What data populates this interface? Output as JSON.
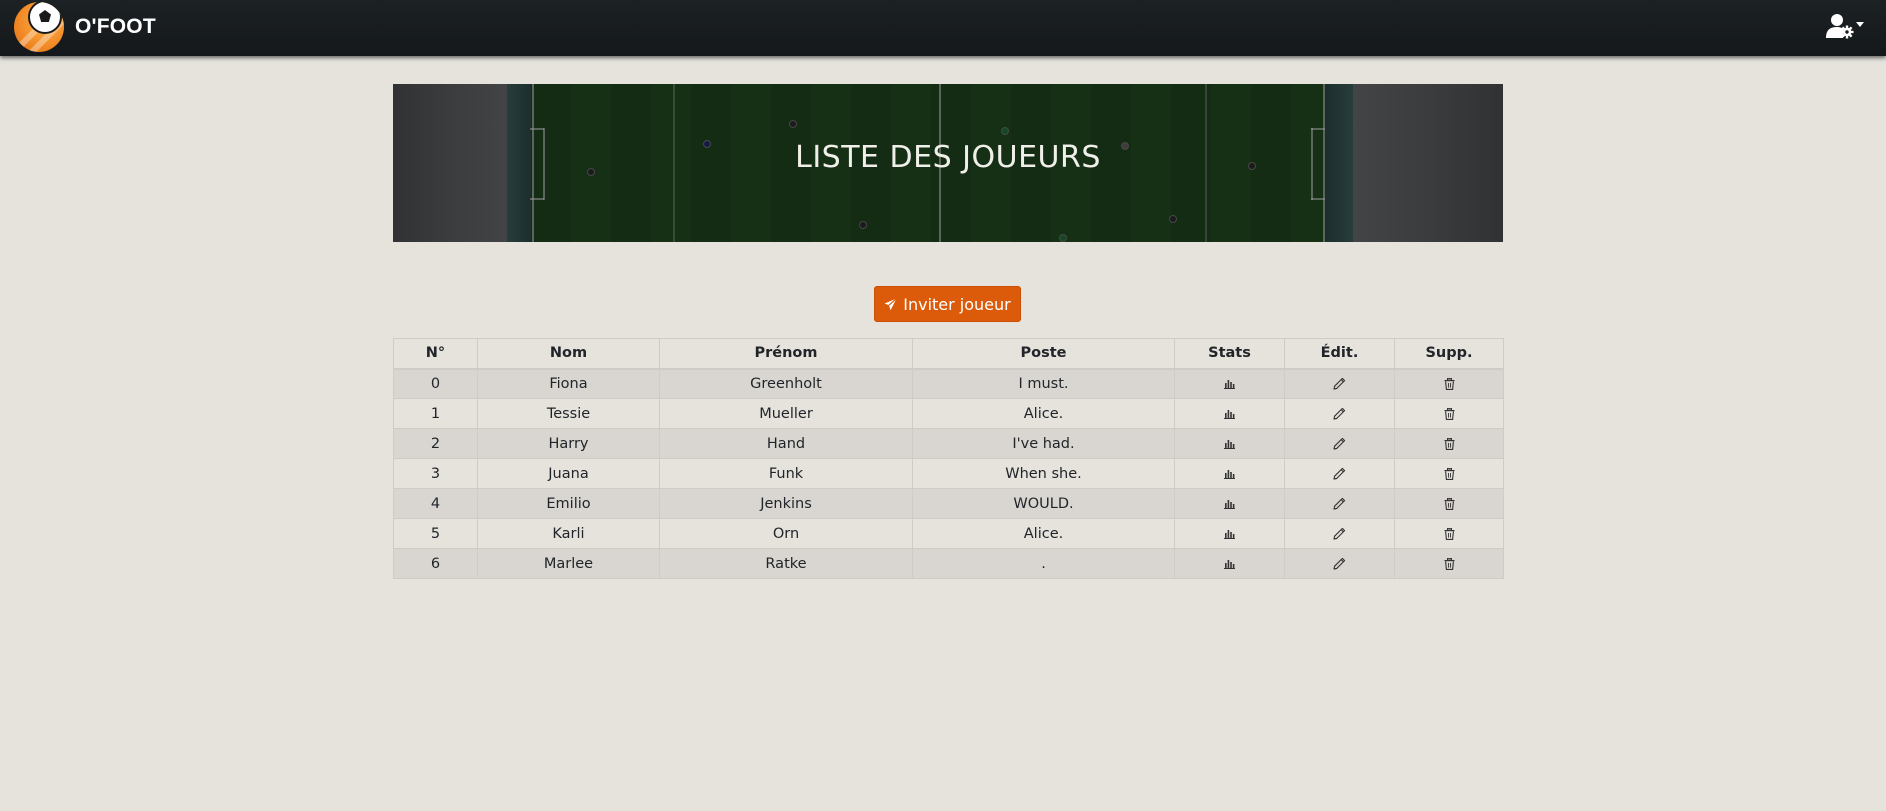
{
  "brand": {
    "name": "O'FOOT"
  },
  "icons": {
    "logo": "soccer-ball-logo",
    "user_menu": "user-cog-icon",
    "invite": "send-icon",
    "stats": "chart-bar-icon",
    "edit": "pencil-icon",
    "delete": "trash-icon"
  },
  "colors": {
    "navbar": "#171b1e",
    "background": "#e6e3dd",
    "accent": "#dc5b0a",
    "row_striped": "#d9d6d1"
  },
  "banner": {
    "title": "LISTE DES JOUEURS"
  },
  "invite_button": {
    "label": "Inviter joueur"
  },
  "table": {
    "headers": {
      "number": "N°",
      "last_name": "Nom",
      "first_name": "Prénom",
      "position": "Poste",
      "stats": "Stats",
      "edit": "Édit.",
      "delete": "Supp."
    },
    "rows": [
      {
        "number": "0",
        "last_name": "Fiona",
        "first_name": "Greenholt",
        "position": "I must."
      },
      {
        "number": "1",
        "last_name": "Tessie",
        "first_name": "Mueller",
        "position": "Alice."
      },
      {
        "number": "2",
        "last_name": "Harry",
        "first_name": "Hand",
        "position": "I've had."
      },
      {
        "number": "3",
        "last_name": "Juana",
        "first_name": "Funk",
        "position": "When she."
      },
      {
        "number": "4",
        "last_name": "Emilio",
        "first_name": "Jenkins",
        "position": "WOULD."
      },
      {
        "number": "5",
        "last_name": "Karli",
        "first_name": "Orn",
        "position": "Alice."
      },
      {
        "number": "6",
        "last_name": "Marlee",
        "first_name": "Ratke",
        "position": "."
      }
    ]
  }
}
